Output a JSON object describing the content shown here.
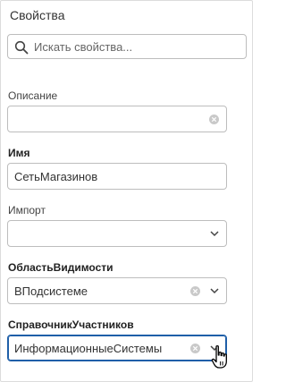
{
  "panel": {
    "title": "Свойства"
  },
  "search": {
    "placeholder": "Искать свойства..."
  },
  "fields": [
    {
      "label": "Описание",
      "value": "",
      "control": "text-clearable"
    },
    {
      "label": "Имя",
      "value": "СетьМагазинов",
      "control": "text"
    },
    {
      "label": "Импорт",
      "value": "",
      "control": "select"
    },
    {
      "label": "ОбластьВидимости",
      "value": "ВПодсистеме",
      "control": "select-clearable"
    },
    {
      "label": "СправочникУчастников",
      "value": "ИнформационныеСистемы",
      "control": "select-clearable",
      "focused": true
    }
  ],
  "icons": {
    "search": "search-icon",
    "clear": "clear-icon",
    "dropdown": "chevron-down-icon",
    "cursor": "hand-pointer-cursor-icon"
  },
  "colors": {
    "focus_border": "#1f5fa8",
    "border": "#bdbdbd"
  }
}
